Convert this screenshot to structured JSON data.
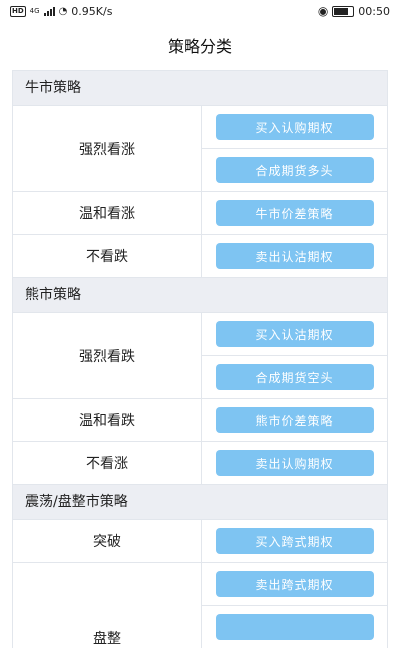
{
  "status_bar": {
    "hd": "HD",
    "net": "4G",
    "speed": "0.95K/s",
    "time": "00:50"
  },
  "header": {
    "title": "策略分类"
  },
  "sections": [
    {
      "title": "牛市策略",
      "rows": [
        {
          "label": "强烈看涨",
          "buttons": [
            "买入认购期权",
            "合成期货多头"
          ]
        },
        {
          "label": "温和看涨",
          "buttons": [
            "牛市价差策略"
          ]
        },
        {
          "label": "不看跌",
          "buttons": [
            "卖出认沽期权"
          ]
        }
      ]
    },
    {
      "title": "熊市策略",
      "rows": [
        {
          "label": "强烈看跌",
          "buttons": [
            "买入认沽期权",
            "合成期货空头"
          ]
        },
        {
          "label": "温和看跌",
          "buttons": [
            "熊市价差策略"
          ]
        },
        {
          "label": "不看涨",
          "buttons": [
            "卖出认购期权"
          ]
        }
      ]
    },
    {
      "title": "震荡/盘整市策略",
      "rows": [
        {
          "label": "突破",
          "buttons": [
            "买入跨式期权"
          ]
        },
        {
          "label": "盘整",
          "buttons": [
            "卖出跨式期权",
            ""
          ]
        }
      ]
    }
  ]
}
